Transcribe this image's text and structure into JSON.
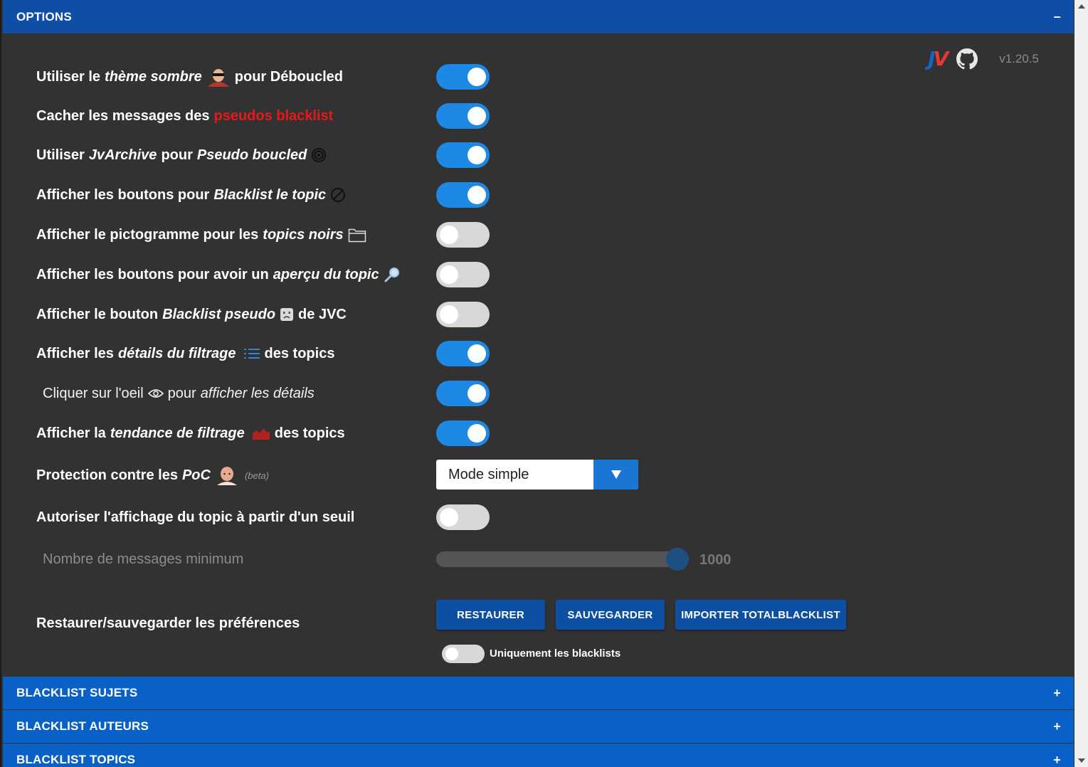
{
  "header": {
    "title": "OPTIONS",
    "collapse_sign": "–"
  },
  "brand": {
    "logo_j": "J",
    "logo_v": "V",
    "version": "v1.20.5",
    "github_icon": "github-icon"
  },
  "options": [
    {
      "pre": "Utiliser le ",
      "em": "thème sombre",
      "post": " pour Déboucled",
      "icon": "sunglasses-avatar-icon",
      "state": "on"
    },
    {
      "pre": "Cacher les messages des ",
      "red": "pseudos blacklist",
      "state": "on"
    },
    {
      "pre": "Utiliser ",
      "em": "JvArchive",
      "mid": " pour ",
      "em2": "Pseudo boucled",
      "icon": "spiral-icon",
      "state": "on"
    },
    {
      "pre": "Afficher les boutons pour ",
      "em": "Blacklist le topic",
      "icon": "prohibited-icon",
      "state": "on"
    },
    {
      "pre": "Afficher le pictogramme pour les ",
      "em": "topics noirs",
      "icon": "folder-icon",
      "state": "off"
    },
    {
      "pre": "Afficher les boutons pour avoir un ",
      "em": "aperçu du topic",
      "icon": "magnifier-icon",
      "state": "off"
    },
    {
      "pre": "Afficher le bouton ",
      "em": "Blacklist pseudo",
      "post": " de JVC",
      "icon": "sad-face-icon",
      "state": "off"
    },
    {
      "pre": "Afficher les ",
      "em": "détails du filtrage",
      "post": " des topics",
      "icon": "list-icon",
      "state": "on"
    },
    {
      "pre": "Cliquer sur l'oeil ",
      "mid": " pour ",
      "em": "afficher les détails",
      "icon": "eye-icon",
      "state": "on"
    },
    {
      "pre": "Afficher la ",
      "em": "tendance de filtrage",
      "post": " des topics",
      "icon": "trend-icon",
      "state": "on"
    }
  ],
  "poc": {
    "pre": "Protection contre les ",
    "em": "PoC",
    "beta": "(beta)",
    "selected": "Mode simple"
  },
  "threshold": {
    "label": "Autoriser l'affichage du topic à partir d'un seuil",
    "state": "off"
  },
  "min_messages": {
    "label": "Nombre de messages minimum",
    "value": "1000",
    "fraction": 1.0
  },
  "backup": {
    "label": "Restaurer/sauvegarder les préférences",
    "restore": "RESTAURER",
    "save": "SAUVEGARDER",
    "import": "IMPORTER TOTALBLACKLIST",
    "only_blacklists": "Uniquement les blacklists"
  },
  "sections": [
    {
      "title": "BLACKLIST SUJETS",
      "sign": "+"
    },
    {
      "title": "BLACKLIST AUTEURS",
      "sign": "+"
    },
    {
      "title": "BLACKLIST TOPICS",
      "sign": "+"
    }
  ]
}
